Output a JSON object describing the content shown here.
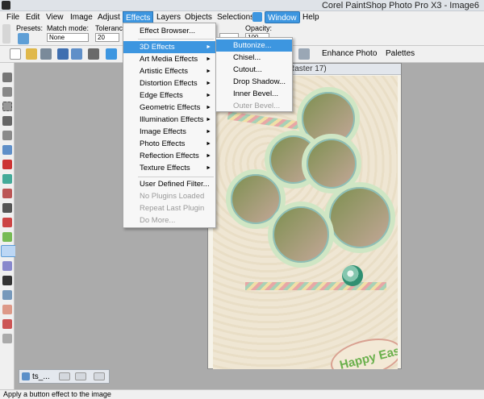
{
  "window": {
    "title": "Corel PaintShop Photo Pro X3 - Image6"
  },
  "menubar": {
    "items": [
      {
        "label": "File"
      },
      {
        "label": "Edit"
      },
      {
        "label": "View"
      },
      {
        "label": "Image"
      },
      {
        "label": "Adjust"
      },
      {
        "label": "Effects"
      },
      {
        "label": "Layers"
      },
      {
        "label": "Objects"
      },
      {
        "label": "Selections"
      },
      {
        "label": "Window"
      },
      {
        "label": "Help"
      }
    ]
  },
  "tool_options": {
    "presets_label": "Presets:",
    "match_mode_label": "Match mode:",
    "match_mode_value": "None",
    "tolerance_label": "Tolerance:",
    "tolerance_value": "20",
    "opacity_label": "Opacity:",
    "opacity_value": "100"
  },
  "toolbar": {
    "enhance_photo": "Enhance Photo",
    "palettes": "Palettes"
  },
  "effects_menu": {
    "items": [
      {
        "label": "Effect Browser..."
      },
      {
        "label": "3D Effects"
      },
      {
        "label": "Art Media Effects"
      },
      {
        "label": "Artistic Effects"
      },
      {
        "label": "Distortion Effects"
      },
      {
        "label": "Edge Effects"
      },
      {
        "label": "Geometric Effects"
      },
      {
        "label": "Illumination Effects"
      },
      {
        "label": "Image Effects"
      },
      {
        "label": "Photo Effects"
      },
      {
        "label": "Reflection Effects"
      },
      {
        "label": "Texture Effects"
      },
      {
        "label": "User Defined Filter..."
      },
      {
        "label": "No Plugins Loaded"
      },
      {
        "label": "Repeat Last Plugin"
      },
      {
        "label": "Do More..."
      }
    ]
  },
  "submenu_3d": {
    "items": [
      {
        "label": "Buttonize..."
      },
      {
        "label": "Chisel..."
      },
      {
        "label": "Cutout..."
      },
      {
        "label": "Drop Shadow..."
      },
      {
        "label": "Inner Bevel..."
      },
      {
        "label": "Outer Bevel..."
      }
    ]
  },
  "document": {
    "title_suffix": "Raster 17)",
    "canvas_text": "Happy Easter!"
  },
  "bottom_tab": {
    "label": "ts_..."
  },
  "status": {
    "text": "Apply a button effect to the image"
  },
  "colors": {
    "accent": "#3d96e0",
    "menu_bg": "#f7f7f7",
    "workspace": "#ababab"
  }
}
